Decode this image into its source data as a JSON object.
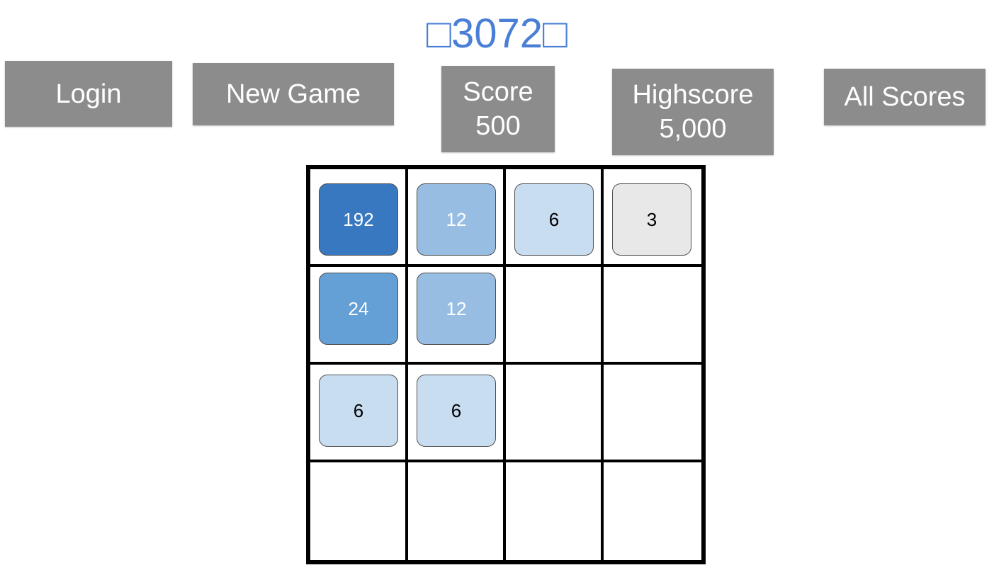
{
  "title": "□3072□",
  "buttons": {
    "login": "Login",
    "new_game": "New Game",
    "all_scores": "All Scores"
  },
  "score": {
    "label": "Score",
    "value": "500"
  },
  "highscore": {
    "label": "Highscore",
    "value": "5,000"
  },
  "board": {
    "size": 4,
    "rows": [
      [
        "192",
        "12",
        "6",
        "3"
      ],
      [
        "24",
        "12",
        "",
        ""
      ],
      [
        "6",
        "6",
        "",
        ""
      ],
      [
        "",
        "",
        "",
        ""
      ]
    ]
  },
  "tile_colors": {
    "3": {
      "bg": "#e8e8e8",
      "fg": "#000000"
    },
    "6": {
      "bg": "#c8ddf0",
      "fg": "#000000"
    },
    "12": {
      "bg": "#97bde3",
      "fg": "#ffffff"
    },
    "24": {
      "bg": "#649fd6",
      "fg": "#ffffff"
    },
    "192": {
      "bg": "#3878c0",
      "fg": "#ffffff"
    }
  },
  "colors": {
    "accent": "#4a7fd8",
    "button_bg": "#8c8c8c",
    "grid_line": "#000000"
  }
}
